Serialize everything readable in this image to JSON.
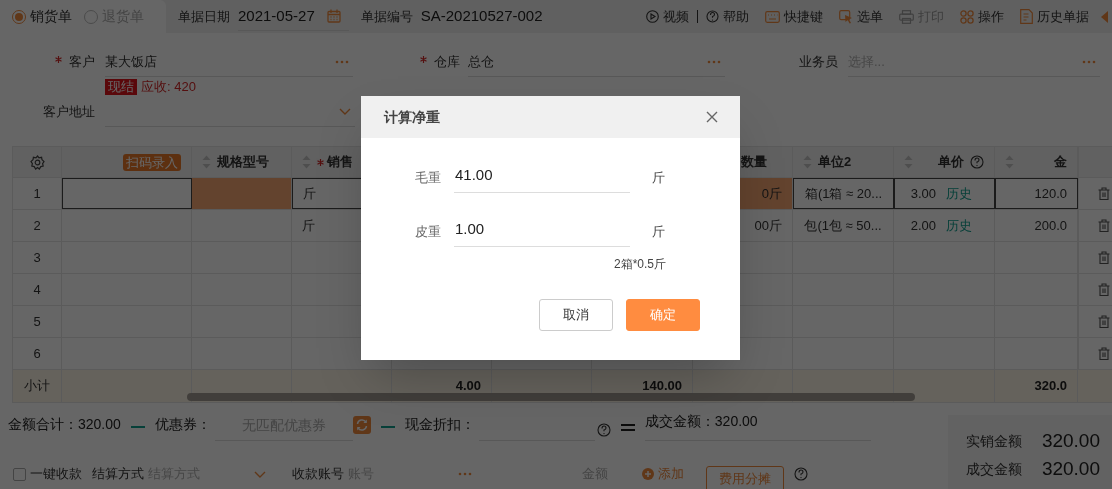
{
  "order_types": [
    {
      "label": "销货单",
      "selected": true
    },
    {
      "label": "退货单",
      "selected": false
    }
  ],
  "header_fields": [
    {
      "label": "单据日期",
      "value": "2021-05-27",
      "kind": "date"
    },
    {
      "label": "单据编号",
      "value": "SA-20210527-002",
      "kind": "text"
    }
  ],
  "toolbar": [
    {
      "label": "视频",
      "disabled": false
    },
    {
      "label": "帮助",
      "disabled": false
    },
    {
      "label": "快捷键",
      "disabled": false
    },
    {
      "label": "选单",
      "disabled": false
    },
    {
      "label": "打印",
      "disabled": true
    },
    {
      "label": "操作",
      "disabled": false
    },
    {
      "label": "历史单据",
      "disabled": false
    }
  ],
  "form": {
    "customer": {
      "label": "客户",
      "required": true,
      "value": "某大饭店"
    },
    "warehouse": {
      "label": "仓库",
      "required": true,
      "value": "总仓"
    },
    "salesperson": {
      "label": "业务员",
      "required": false,
      "placeholder": "选择..."
    },
    "settlement_badge": "现结",
    "receivable": "应收: 420",
    "address": {
      "label": "客户地址"
    }
  },
  "table": {
    "columns": [
      {
        "label": "扫码录入",
        "kind": "scan"
      },
      {
        "label": "规格型号",
        "kind": "sort",
        "required": false
      },
      {
        "label": "销售",
        "kind": "sort",
        "required": true
      },
      {},
      {},
      {},
      {
        "label": "数量",
        "kind": "plain"
      },
      {
        "label": "单位2",
        "kind": "sort",
        "required": false
      },
      {
        "label": "单价",
        "kind": "sort-help",
        "required": false
      },
      {
        "label": "金",
        "kind": "sort",
        "required": false
      }
    ],
    "rows": [
      {
        "number": "1",
        "selected": true,
        "sales_unit": "斤",
        "quantity": "0斤",
        "unit2": "箱(1箱 ≈ 20...",
        "price": "3.00",
        "price_link": "历史",
        "amount": "120.0"
      },
      {
        "number": "2",
        "selected": false,
        "sales_unit": "斤",
        "quantity": "00斤",
        "unit2": "包(1包 ≈ 50...",
        "price": "2.00",
        "price_link": "历史",
        "amount": "200.0"
      },
      {
        "number": "3",
        "selected": false
      },
      {
        "number": "4",
        "selected": false
      },
      {
        "number": "5",
        "selected": false
      },
      {
        "number": "6",
        "selected": false
      }
    ],
    "summary": {
      "label": "小计",
      "column_4": "4.00",
      "column_6": "140.00",
      "amount": "320.0"
    }
  },
  "totals": {
    "amount_total": "金额合计：320.00",
    "coupon_label": "优惠券：",
    "coupon_placeholder": "无匹配优惠券",
    "cash_discount_label": "现金折扣：",
    "deal_amount": "成交金额：320.00"
  },
  "summary_panel": [
    {
      "label": "实销金额",
      "value": "320.00"
    },
    {
      "label": "成交金额",
      "value": "320.00"
    }
  ],
  "payment": {
    "one_click": {
      "label": "一键收款",
      "checked": false
    },
    "method_label": "结算方式",
    "method_placeholder": "结算方式",
    "account_label": "收款账号",
    "account_placeholder": "账号",
    "amount_label": "金额",
    "add": "添加",
    "cost_split": "费用分摊"
  },
  "dialog": {
    "title": "计算净重",
    "fields": [
      {
        "label": "毛重",
        "value": "41.00",
        "unit": "斤"
      },
      {
        "label": "皮重",
        "value": "1.00",
        "unit": "斤"
      }
    ],
    "note": "2箱*0.5斤",
    "buttons": [
      {
        "label": "取消",
        "kind": "secondary"
      },
      {
        "label": "确定",
        "kind": "primary"
      }
    ]
  }
}
